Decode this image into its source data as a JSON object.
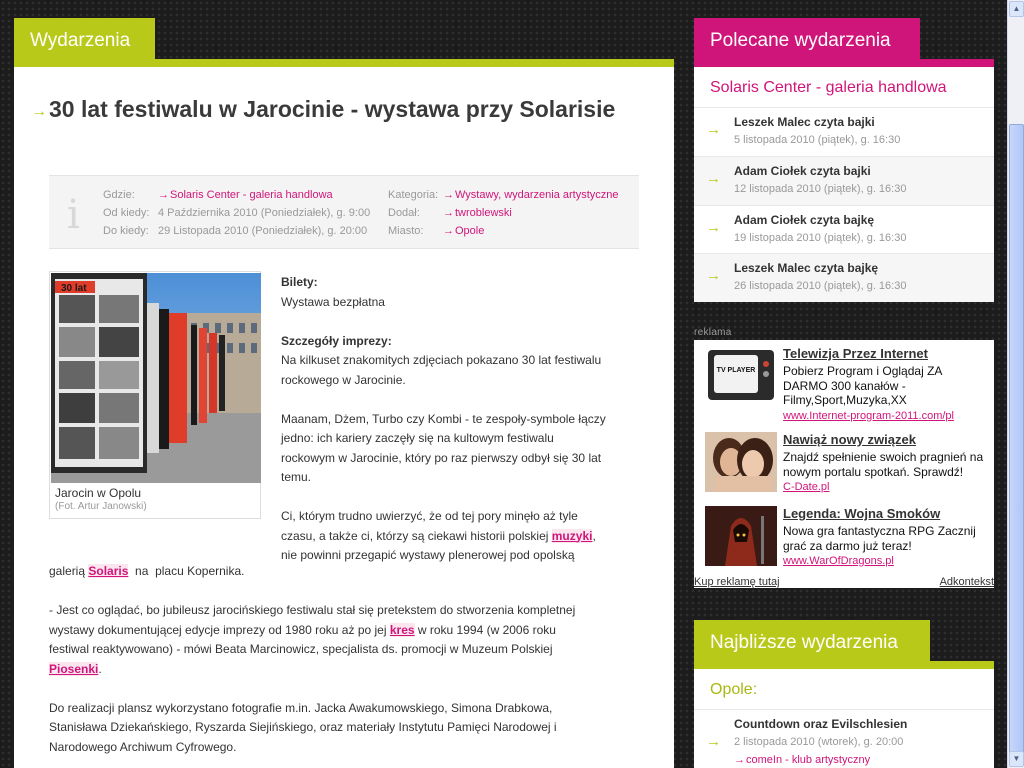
{
  "main": {
    "tab_label": "Wydarzenia",
    "title": "30 lat festiwalu w Jarocinie - wystawa przy Solarisie",
    "info": {
      "where_label": "Gdzie:",
      "where_value": "Solaris Center - galeria handlowa",
      "from_label": "Od kiedy:",
      "from_value": "4 Października 2010 (Poniedziałek), g. 9:00",
      "to_label": "Do kiedy:",
      "to_value": "29 Listopada 2010 (Poniedziałek), g. 20:00",
      "category_label": "Kategoria:",
      "category_value": "Wystawy, wydarzenia artystyczne",
      "added_label": "Dodał:",
      "added_value": "twroblewski",
      "city_label": "Miasto:",
      "city_value": "Opole"
    },
    "photo": {
      "caption": "Jarocin w Opolu",
      "credit": "(Fot. Artur Janowski)",
      "sign_text": "30 lat"
    },
    "tickets_heading": "Bilety:",
    "tickets_text": "Wystawa bezpłatna",
    "details_heading": "Szczegóły imprezy:",
    "p1_l1": "Na kilkuset znakomitych zdjęciach pokazano 30 lat festiwalu",
    "p1_l2": "rockowego w Jarocinie.",
    "p2_l1": "Maanam, Dżem, Turbo czy Kombi - te zespoły-symbole łączy",
    "p2_l2": "jedno: ich kariery zaczęły się na kultowym festiwalu",
    "p2_l3": "rockowym w Jarocinie, który po raz pierwszy odbył się 30 lat",
    "p2_l4": "temu.",
    "p3_l1": "Ci, którym trudno uwierzyć, że od tej pory minęło aż tyle",
    "p3_l2_pre": "czasu, a także ci, którzy są ciekawi historii polskiej ",
    "p3_l2_kw": "muzyki",
    "p3_l2_post": ",",
    "p3_l3": "nie powinni przegapić wystawy plenerowej pod opolską",
    "p3_l4_pre": "galerią ",
    "p3_l4_kw": "Solaris",
    "p3_l4_post": "  na  placu Kopernika.",
    "p4_l1": "- Jest co oglądać, bo jubileusz jarocińskiego festiwalu stał się pretekstem do  stworzenia kompletnej",
    "p4_l2_pre": "wystawy dokumentującej edycje imprezy od 1980 roku aż po jej ",
    "p4_l2_kw": "kres",
    "p4_l2_post": " w roku 1994 (w 2006 roku",
    "p4_l3": "festiwal reaktywowano) - mówi Beata Marcinowicz, specjalista ds. promocji w  Muzeum Polskiej",
    "p4_l4_kw": "Piosenki",
    "p4_l4_post": ".",
    "p5_l1": "Do realizacji plansz wykorzystano fotografie m.in. Jacka Awakumowskiego, Simona Drabkowa,",
    "p5_l2": "Stanisława Dziekańskiego, Ryszarda Siejińskiego, oraz materiały Instytutu Pamięci Narodowej i",
    "p5_l3": "Narodowego Archiwum Cyfrowego."
  },
  "sidebar": {
    "recommended_tab": "Polecane wydarzenia",
    "venue": "Solaris Center - galeria handlowa",
    "items": [
      {
        "name": "Leszek Malec czyta bajki",
        "date": "5 listopada 2010 (piątek), g. 16:30"
      },
      {
        "name": "Adam Ciołek czyta bajki",
        "date": "12 listopada 2010 (piątek), g. 16:30"
      },
      {
        "name": "Adam Ciołek czyta bajkę",
        "date": "19 listopada 2010 (piątek), g. 16:30"
      },
      {
        "name": "Leszek Malec czyta bajkę",
        "date": "26 listopada 2010 (piątek), g. 16:30"
      }
    ],
    "ads_label": "reklama",
    "ads": [
      {
        "title": "Telewizja Przez Internet",
        "text": "Pobierz Program i Oglądaj ZA DARMO 300 kanałów - Filmy,Sport,Muzyka,XX",
        "url": "www.Internet-program-2011.com/pl",
        "img_text": "TV PLAYER"
      },
      {
        "title": "Nawiąż nowy związek",
        "text": "Znajdź spełnienie swoich pragnień na nowym portalu spotkań. Sprawdź!",
        "url": "C-Date.pl"
      },
      {
        "title": "Legenda: Wojna Smoków",
        "text": "Nowa gra fantastyczna RPG Zacznij grać za darmo już teraz!",
        "url": "www.WarOfDragons.pl"
      }
    ],
    "ads_buy": "Kup reklamę tutaj",
    "ads_provider": "Adkontekst",
    "nearest_tab": "Najbliższe wydarzenia",
    "nearest_city": "Opole:",
    "nearest_items": [
      {
        "name": "Countdown oraz Evilschlesien",
        "date": "2 listopada 2010 (wtorek), g. 20:00",
        "venue": "comeIn - klub artystyczny"
      }
    ]
  },
  "colors": {
    "lime": "#b9c91a",
    "magenta": "#d0157a",
    "background": "#1c1c1c"
  }
}
